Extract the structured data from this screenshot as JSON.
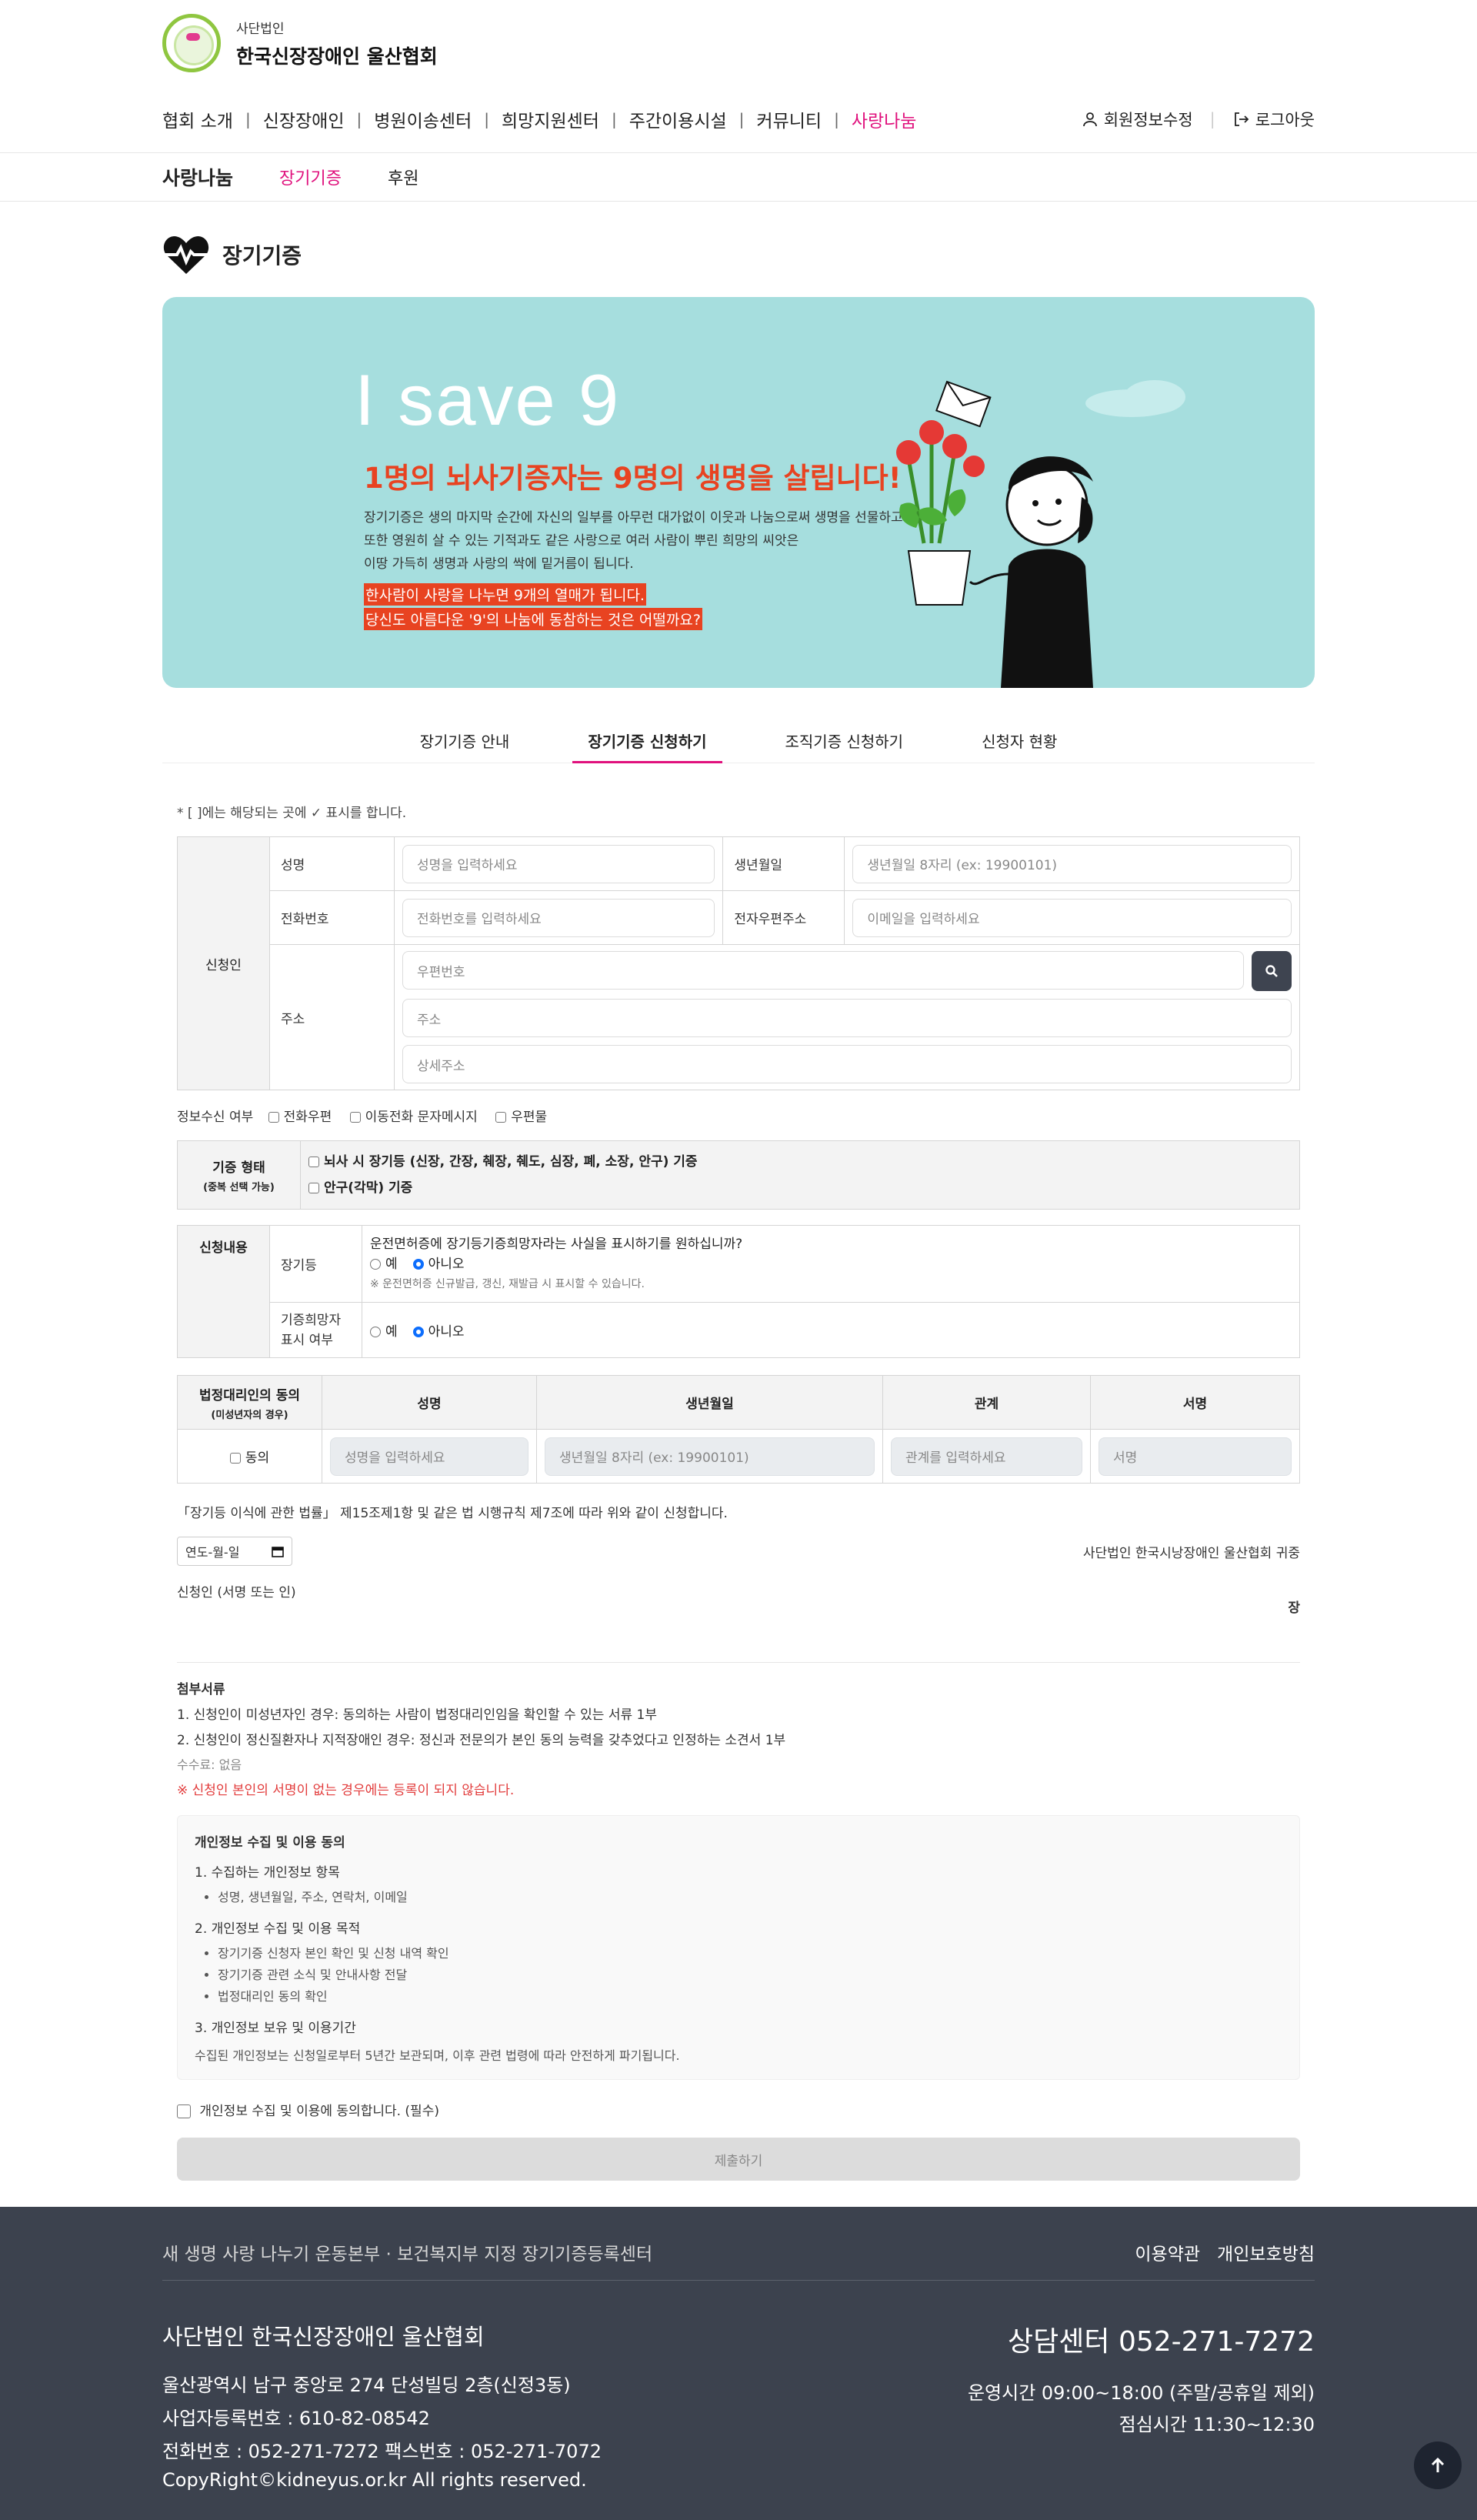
{
  "header": {
    "brand_sub": "사단법인",
    "brand_main": "한국신장장애인 울산협회",
    "nav": [
      "협회 소개",
      "신장장애인",
      "병원이송센터",
      "희망지원센터",
      "주간이용시설",
      "커뮤니티",
      "사랑나눔"
    ],
    "active_nav": "사랑나눔",
    "user_edit": "회원정보수정",
    "logout": "로그아웃"
  },
  "subnav": {
    "title": "사랑나눔",
    "items": [
      "장기기증",
      "후원"
    ]
  },
  "page": {
    "title": "장기기증"
  },
  "banner": {
    "big": "I save 9",
    "headline": "1명의 뇌사기증자는 9명의 생명을 살립니다!",
    "paragraph": [
      "장기기증은 생의 마지막 순간에 자신의 일부를 아무런 대가없이 이웃과 나눔으로써 생명을 선물하고",
      "또한 영원히 살 수 있는 기적과도 같은 사랑으로 여러 사람이 뿌린 희망의 씨앗은",
      "이땅 가득히 생명과 사랑의 싹에 밑거름이 됩니다."
    ],
    "highlight": [
      "한사람이 사랑을 나누면 9개의 열매가 됩니다.",
      "당신도 아름다운 '9'의 나눔에 동참하는 것은 어떨까요?"
    ],
    "colors": {
      "bg": "#a6dede",
      "accent": "#e84321"
    }
  },
  "tabs": [
    "장기기증 안내",
    "장기기증 신청하기",
    "조직기증 신청하기",
    "신청자 현황"
  ],
  "active_tab": "장기기증 신청하기",
  "form": {
    "note": "* [ ]에는 해당되는 곳에 ✓ 표시를 합니다.",
    "applicant_label": "신청인",
    "name_label": "성명",
    "name_ph": "성명을 입력하세요",
    "birth_label": "생년월일",
    "birth_ph": "생년월일 8자리 (ex: 19900101)",
    "phone_label": "전화번호",
    "phone_ph": "전화번호를 입력하세요",
    "email_label": "전자우편주소",
    "email_ph": "이메일을 입력하세요",
    "address_label": "주소",
    "zip_ph": "우편번호",
    "addr_ph": "주소",
    "addr_detail_ph": "상세주소",
    "receive_label": "정보수신 여부",
    "receive_options": [
      "전화우편",
      "이동전화 문자메시지",
      "우편물"
    ],
    "donation_type_label": "기증 형태",
    "donation_type_sub": "(중복 선택 가능)",
    "donation_types": [
      "뇌사 시 장기등 (신장, 간장, 췌장, 췌도, 심장, 폐, 소장, 안구) 기증",
      "안구(각막) 기증"
    ],
    "content_label": "신청내용",
    "organs_label": "장기등",
    "license_question": "운전면허증에 장기등기증희망자라는 사실을 표시하기를 원하십니까?",
    "yes": "예",
    "no": "아니오",
    "license_note": "※ 운전면허증 신규발급, 갱신, 재발급 시 표시할 수 있습니다.",
    "hope_label_1": "기증희망자",
    "hope_label_2": "표시 여부",
    "guardian_label": "법정대리인의 동의",
    "guardian_sub": "(미성년자의 경우)",
    "guardian_cols": [
      "성명",
      "생년월일",
      "관계",
      "서명"
    ],
    "consent_label": "동의",
    "g_name_ph": "성명을 입력하세요",
    "g_birth_ph": "생년월일 8자리 (ex: 19900101)",
    "g_rel_ph": "관계를 입력하세요",
    "g_sign_ph": "서명",
    "law_text": "「장기등 이식에 관한 법률」 제15조제1항 및 같은 법 시행규칙 제7조에 따라 위와 같이 신청합니다.",
    "date_ph": "연도-월-일",
    "recipient": "사단법인 한국시낭장애인 울산협회 귀중",
    "signer": "신청인 (서명 또는 인)",
    "seal": "장"
  },
  "attach": {
    "title": "첨부서류",
    "items": [
      "1. 신청인이 미성년자인 경우: 동의하는 사람이 법정대리인임을 확인할 수 있는 서류 1부",
      "2. 신청인이 정신질환자나 지적장애인 경우: 정신과 전문의가 본인 동의 능력을 갖추었다고 인정하는 소견서 1부"
    ],
    "fee": "수수료: 없음",
    "warning": "※ 신청인 본인의 서명이 없는 경우에는 등록이 되지 않습니다."
  },
  "privacy": {
    "title": "개인정보 수집 및 이용 동의",
    "s1": "1. 수집하는 개인정보 항목",
    "s1_items": [
      "성명, 생년월일, 주소, 연락처, 이메일"
    ],
    "s2": "2. 개인정보 수집 및 이용 목적",
    "s2_items": [
      "장기기증 신청자 본인 확인 및 신청 내역 확인",
      "장기기증 관련 소식 및 안내사항 전달",
      "법정대리인 동의 확인"
    ],
    "s3": "3. 개인정보 보유 및 이용기간",
    "s3_text": "수집된 개인정보는 신청일로부터 5년간 보관되며, 이후 관련 법령에 따라 안전하게 파기됩니다.",
    "agree": "개인정보 수집 및 이용에 동의합니다. (필수)",
    "submit": "제출하기"
  },
  "footer": {
    "slogan": "새 생명 사랑 나누기 운동본부 · 보건복지부 지정 장기기증등록센터",
    "links": [
      "이용약관",
      "개인보호방침"
    ],
    "org": "사단법인 한국신장장애인 울산협회",
    "address": "울산광역시 남구 중앙로 274 단성빌딩 2층(신정3동)",
    "bizno": "사업자등록번호 : 610-82-08542",
    "tel": "전화번호 : 052-271-7272 팩스번호 : 052-271-7072",
    "copyright": "CopyRight©kidneyus.or.kr All rights reserved.",
    "center": "상담센터 052-271-7272",
    "hours": "운영시간 09:00~18:00 (주말/공휴일 제외)",
    "lunch": "점심시간 11:30~12:30"
  }
}
